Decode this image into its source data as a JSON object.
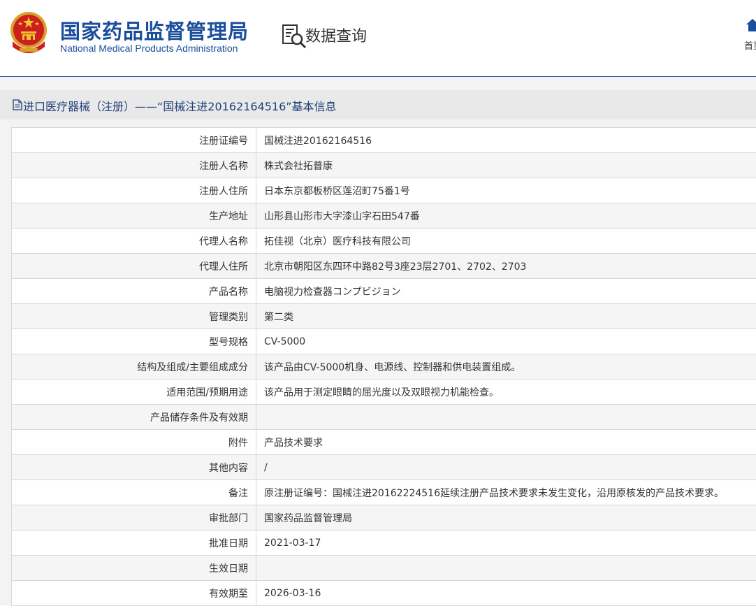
{
  "header": {
    "site_title_cn": "国家药品监督管理局",
    "site_title_en": "National Medical Products Administration",
    "query_label": "数据查询",
    "home_label": "首页",
    "brand_color": "#1a4d9c",
    "icons": {
      "emblem": "national-emblem-icon",
      "query": "document-search-icon",
      "home": "home-icon"
    }
  },
  "section": {
    "title": "进口医疗器械（注册）——“国械注进20162164516”基本信息",
    "icon": "document-icon",
    "title_color": "#1f3f7a"
  },
  "rows": [
    {
      "label": "注册证编号",
      "value": "国械注进20162164516"
    },
    {
      "label": "注册人名称",
      "value": "株式会社拓普康"
    },
    {
      "label": "注册人住所",
      "value": "日本东京都板桥区莲沼町75番1号"
    },
    {
      "label": "生产地址",
      "value": "山形县山形市大字漆山字石田547番"
    },
    {
      "label": "代理人名称",
      "value": "拓佳视（北京）医疗科技有限公司"
    },
    {
      "label": "代理人住所",
      "value": "北京市朝阳区东四环中路82号3座23层2701、2702、2703"
    },
    {
      "label": "产品名称",
      "value": "电脑视力检查器コンプビジョン"
    },
    {
      "label": "管理类别",
      "value": "第二类"
    },
    {
      "label": "型号规格",
      "value": "CV-5000"
    },
    {
      "label": "结构及组成/主要组成成分",
      "value": "该产品由CV-5000机身、电源线、控制器和供电装置组成。"
    },
    {
      "label": "适用范围/预期用途",
      "value": "该产品用于测定眼睛的屈光度以及双眼视力机能检查。"
    },
    {
      "label": "产品储存条件及有效期",
      "value": ""
    },
    {
      "label": "附件",
      "value": "产品技术要求"
    },
    {
      "label": "其他内容",
      "value": "/"
    },
    {
      "label": "备注",
      "value": "原注册证编号：国械注进20162224516延续注册产品技术要求未发生变化，沿用原核发的产品技术要求。"
    },
    {
      "label": "审批部门",
      "value": "国家药品监督管理局"
    },
    {
      "label": "批准日期",
      "value": "2021-03-17"
    },
    {
      "label": "生效日期",
      "value": ""
    },
    {
      "label": "有效期至",
      "value": "2026-03-16"
    }
  ]
}
